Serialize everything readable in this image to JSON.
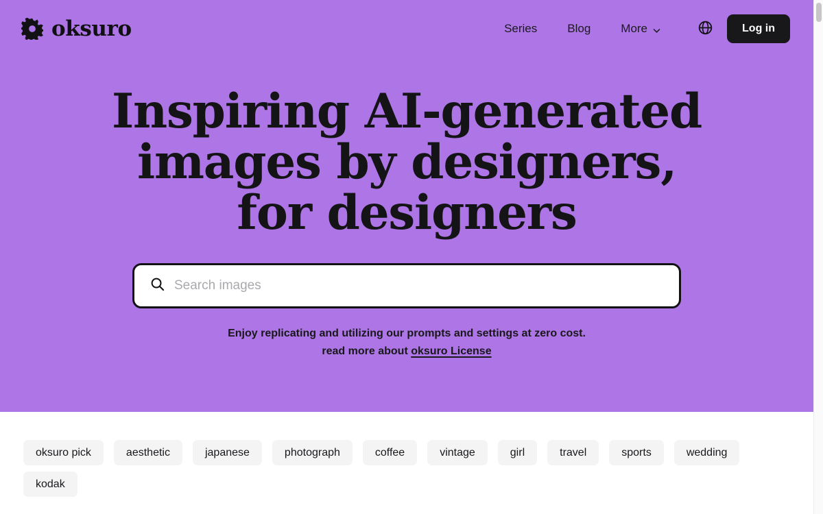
{
  "brand": {
    "name": "oksuro",
    "icon": "gear-icon"
  },
  "nav": {
    "links": [
      {
        "label": "Series",
        "icon": null
      },
      {
        "label": "Blog",
        "icon": null
      },
      {
        "label": "More",
        "icon": "chevron-down-icon"
      }
    ],
    "language_icon": "globe-icon",
    "login_label": "Log in"
  },
  "hero": {
    "background_color": "#ad75e6",
    "headline_lines": [
      "Inspiring  AI-generated",
      "images by designers,",
      "for designers"
    ],
    "search": {
      "icon": "search-icon",
      "placeholder": "Search images",
      "value": ""
    },
    "tagline": {
      "line1": "Enjoy replicating and utilizing our prompts and settings at zero cost.",
      "line2_prefix": "read more about ",
      "line2_link": "oksuro License"
    }
  },
  "tags": {
    "items": [
      "oksuro pick",
      "aesthetic",
      "japanese",
      "photograph",
      "coffee",
      "vintage",
      "girl",
      "travel",
      "sports",
      "wedding",
      "kodak"
    ]
  },
  "colors": {
    "hero_purple": "#ad75e6",
    "ink": "#18181b",
    "chip_bg": "#f4f4f5",
    "placeholder": "#a9a9ae"
  }
}
